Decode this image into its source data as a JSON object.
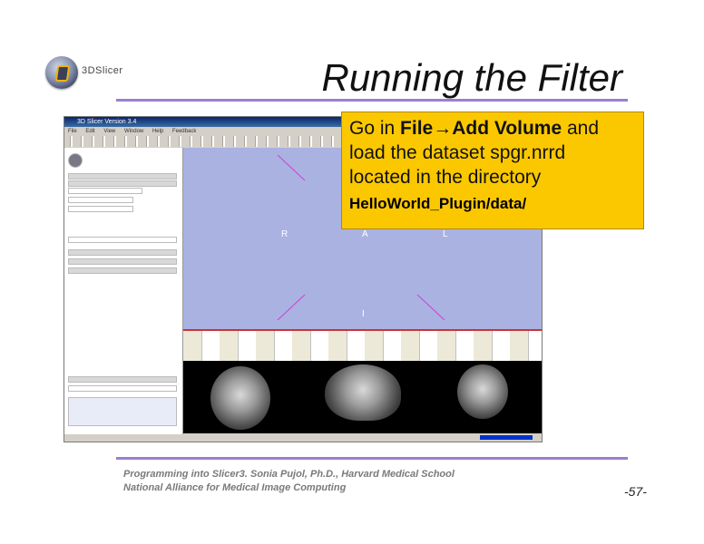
{
  "logo": {
    "text": "3DSlicer"
  },
  "slide": {
    "title": "Running the Filter",
    "page_number": "-57-"
  },
  "app_window": {
    "title": "3D Slicer Version 3.4",
    "menu": [
      "File",
      "Edit",
      "View",
      "Window",
      "Help",
      "Feedback"
    ],
    "view_labels": {
      "R": "R",
      "A": "A",
      "L": "L",
      "I": "I"
    }
  },
  "callout": {
    "text_1": "Go in ",
    "file": "File",
    "arrow": "→",
    "add_volume": "Add Volume",
    "text_2": " and",
    "line_2": "load the dataset spgr.nrrd",
    "line_3": "located in the directory",
    "directory": "HelloWorld_Plugin/data/"
  },
  "footer": {
    "line_1": "Programming into Slicer3. Sonia Pujol, Ph.D., Harvard Medical School",
    "line_2": "National Alliance for Medical Image Computing"
  }
}
